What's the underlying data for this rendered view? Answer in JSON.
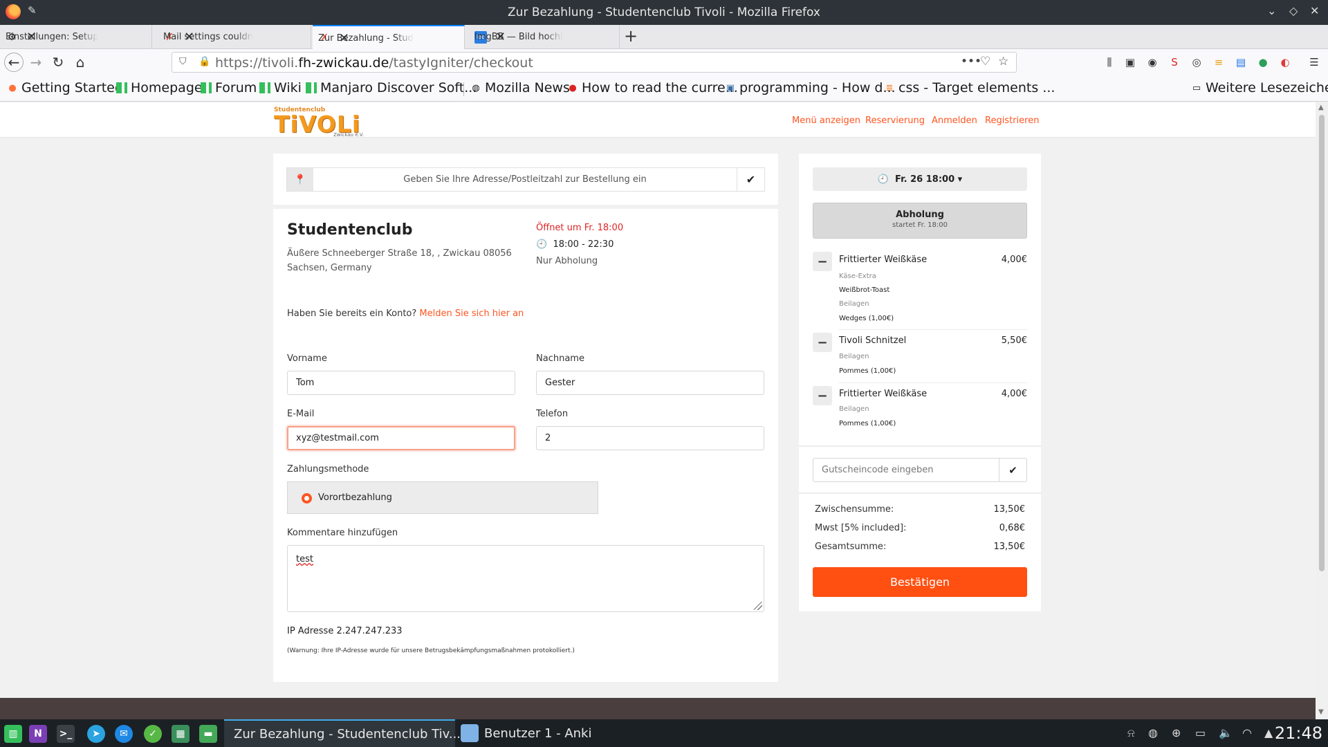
{
  "window": {
    "title": "Zur Bezahlung - Studentenclub Tivoli - Mozilla Firefox",
    "controls": [
      "⌄",
      "◇",
      "✕"
    ]
  },
  "tabs": [
    {
      "label": "Einstellungen: Setup",
      "icon": "settings-icon",
      "active": false
    },
    {
      "label": "Mail settings couldn",
      "icon": "tasty-igniter-icon",
      "active": false
    },
    {
      "label": "Zur Bezahlung - Stud",
      "icon": "tasty-igniter-icon",
      "active": true
    },
    {
      "label": "ImgBB — Bild hochl",
      "icon": "imgbb-icon",
      "active": false
    }
  ],
  "new_tab": "+",
  "nav": {
    "url_prefix": "https://tivoli.",
    "url_domain": "fh-zwickau.de",
    "url_path": "/tastyIgniter/checkout"
  },
  "bookmarks": [
    {
      "label": "Getting Started",
      "icon": "firefox-icon"
    },
    {
      "label": "Homepage",
      "icon": "manjaro-icon"
    },
    {
      "label": "Forum",
      "icon": "manjaro-icon"
    },
    {
      "label": "Wiki",
      "icon": "manjaro-icon"
    },
    {
      "label": "Manjaro Discover Soft...",
      "icon": "manjaro-icon"
    },
    {
      "label": "Mozilla News",
      "icon": "globe-icon"
    },
    {
      "label": "How to read the curre...",
      "icon": "bookmark-icon"
    },
    {
      "label": "programming - How d...",
      "icon": "stackexchange-icon"
    },
    {
      "label": "css - Target elements ...",
      "icon": "stackoverflow-icon"
    }
  ],
  "other_bookmarks": "Weitere Lesezeichen",
  "site": {
    "logo_top": "Studentenclub",
    "logo_main": "TiVOLi",
    "logo_sub": "Zwickau e.V.",
    "nav": [
      "Menü anzeigen",
      "Reservierung",
      "Anmelden",
      "Registrieren"
    ]
  },
  "address_search": {
    "placeholder": "Geben Sie Ihre Adresse/Postleitzahl zur Bestellung ein"
  },
  "location": {
    "name": "Studentenclub",
    "address_line1": "Äußere Schneeberger Straße 18, , Zwickau 08056",
    "address_line2": "Sachsen, Germany",
    "opens": "Öffnet um Fr. 18:00",
    "hours": "18:00 - 22:30",
    "mode": "Nur Abholung"
  },
  "login_prompt": {
    "text": "Haben Sie bereits ein Konto?",
    "link": "Melden Sie sich hier an"
  },
  "form": {
    "first_name_label": "Vorname",
    "first_name_value": "Tom",
    "last_name_label": "Nachname",
    "last_name_value": "Gester",
    "email_label": "E-Mail",
    "email_value": "xyz@testmail.com",
    "phone_label": "Telefon",
    "phone_value": "2",
    "payment_label": "Zahlungsmethode",
    "payment_option": "Vorortbezahlung",
    "comment_label": "Kommentare hinzufügen",
    "comment_value": "test",
    "ip_text": "IP Adresse 2.247.247.233",
    "ip_warning": "(Warnung: Ihre IP-Adresse wurde für unsere Betrugsbekämpfungsmaßnahmen protokolliert.)"
  },
  "order": {
    "time": "Fr. 26 18:00",
    "pickup_title": "Abholung",
    "pickup_sub": "startet Fr. 18:00",
    "items": [
      {
        "name": "Frittierter Weißkäse",
        "price": "4,00€",
        "options": [
          {
            "group": "Käse-Extra",
            "value": "Weißbrot-Toast"
          },
          {
            "group": "Beilagen",
            "value": "Wedges (1,00€)"
          }
        ]
      },
      {
        "name": "Tivoli Schnitzel",
        "price": "5,50€",
        "options": [
          {
            "group": "Beilagen",
            "value": "Pommes (1,00€)"
          }
        ]
      },
      {
        "name": "Frittierter Weißkäse",
        "price": "4,00€",
        "options": [
          {
            "group": "Beilagen",
            "value": "Pommes (1,00€)"
          }
        ]
      }
    ],
    "coupon_placeholder": "Gutscheincode eingeben",
    "subtotal_label": "Zwischensumme:",
    "subtotal_value": "13,50€",
    "tax_label": "Mwst [5% included]:",
    "tax_value": "0,68€",
    "total_label": "Gesamtsumme:",
    "total_value": "13,50€",
    "confirm_label": "Bestätigen"
  },
  "taskbar": {
    "tasks": [
      {
        "label": "Zur Bezahlung - Studentenclub Tiv...",
        "active": true
      },
      {
        "label": "Benutzer 1 - Anki",
        "active": false
      }
    ],
    "clock": "21:48",
    "onenote_letter": "N"
  },
  "colors": {
    "accent": "#ff5421",
    "confirm_button": "#ff4f11",
    "opens_red": "#e02424",
    "titlebar": "#2d3338"
  }
}
